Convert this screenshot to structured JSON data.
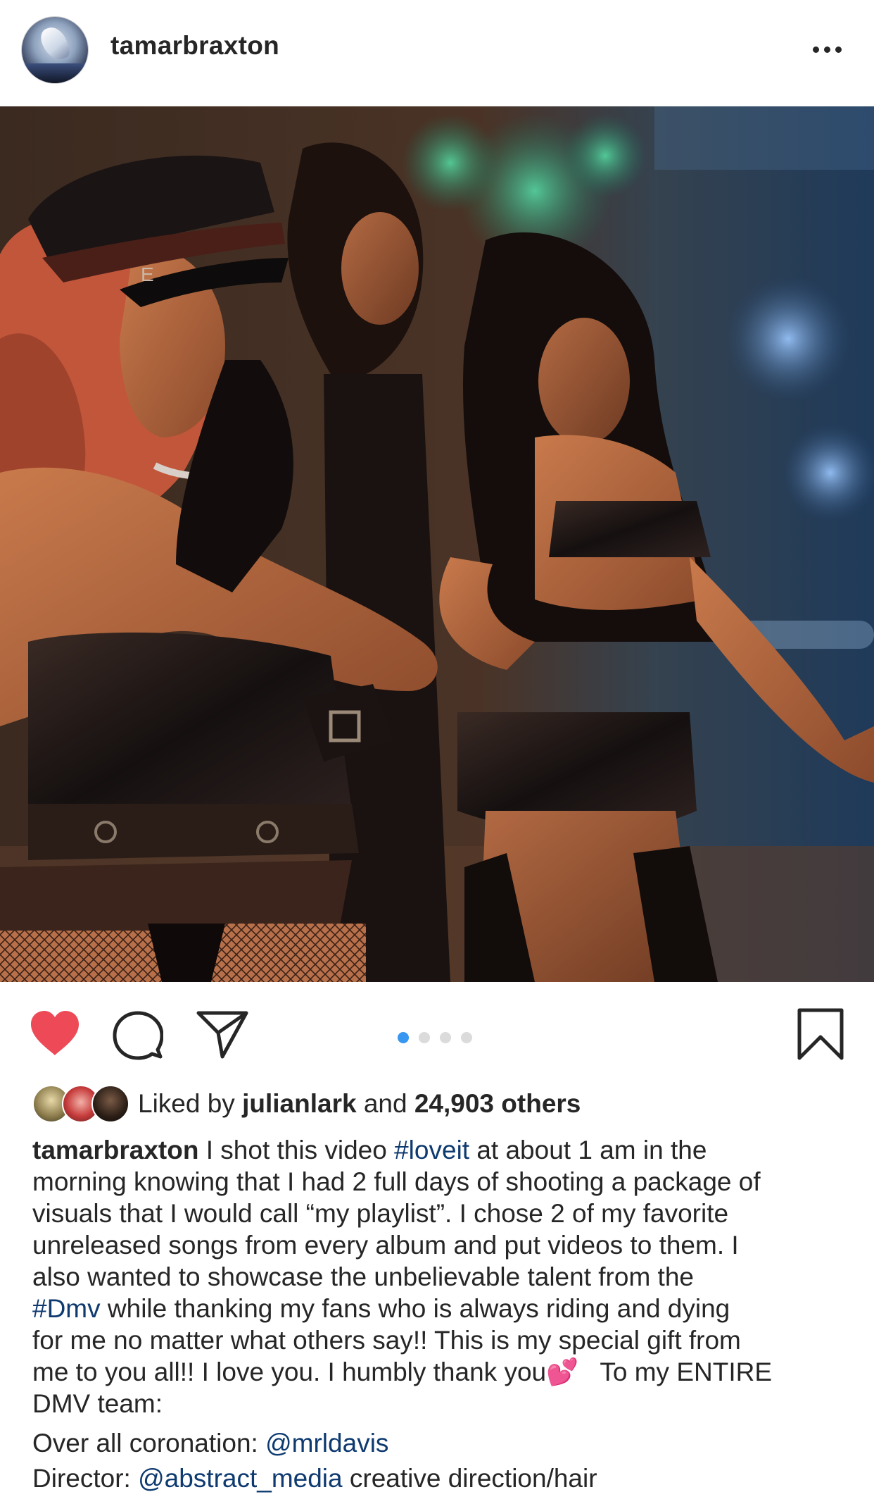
{
  "header": {
    "username": "tamarbraxton",
    "avatar_icon": "profile-avatar",
    "more_icon": "more-options-icon"
  },
  "post": {
    "image_description_icon": "post-photo",
    "carousel": {
      "count": 4,
      "active_index": 0,
      "active_color": "#3897f0",
      "inactive_color": "#dbdbdb"
    }
  },
  "actions": {
    "heart_color": "#ed4956"
  },
  "likes": {
    "prefix": "Liked by ",
    "user": "julianlark",
    "middle": " and ",
    "count_text": "24,903 others"
  },
  "caption": {
    "username": "tamarbraxton",
    "line1_a": " I shot this video ",
    "hashtag1": "#loveit",
    "line1_b": " at about 1 am in the",
    "line2": "morning knowing that I had 2 full days of shooting a package of",
    "line3": "visuals that I would call “my playlist”. I chose 2 of my favorite",
    "line4": "unreleased songs from every album and put videos to them. I",
    "line5": "also wanted to showcase the unbelievable talent from the",
    "hashtag2": "#Dmv",
    "line6_b": " while thanking my fans who is always riding and dying",
    "line7": "for me no matter what others say!! This is my special gift from",
    "line8_a": "me to you all!! I love you. I humbly thank you",
    "emoji": "💕",
    "line8_b": "   To my ENTIRE",
    "line9": "DMV team:"
  },
  "credits": {
    "line1_label": "Over all coronation: ",
    "line1_handle": "@mrldavis",
    "line2_label": "Director: ",
    "line2_handle": "@abstract_media",
    "line2_rest": " creative direction/hair"
  }
}
